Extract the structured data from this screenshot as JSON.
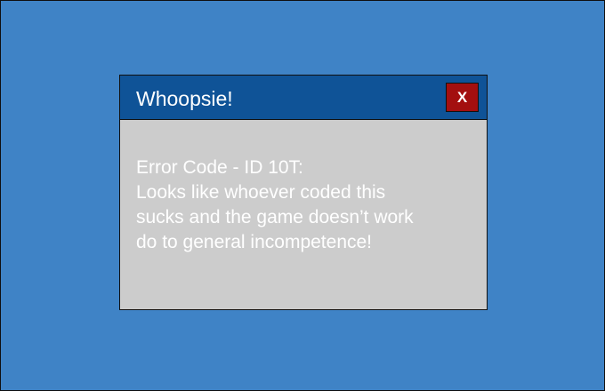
{
  "dialog": {
    "title": "Whoopsie!",
    "close_label": "X",
    "message_lines": [
      "Error Code - ID 10T:",
      "Looks like whoever coded this",
      "sucks and the game doesn’t work",
      "do to general incompetence!"
    ]
  },
  "colors": {
    "background": "#3f83c6",
    "titlebar": "#0f5397",
    "dialog_body": "#cccccc",
    "close_button": "#a30f0f",
    "text": "#ffffff"
  }
}
